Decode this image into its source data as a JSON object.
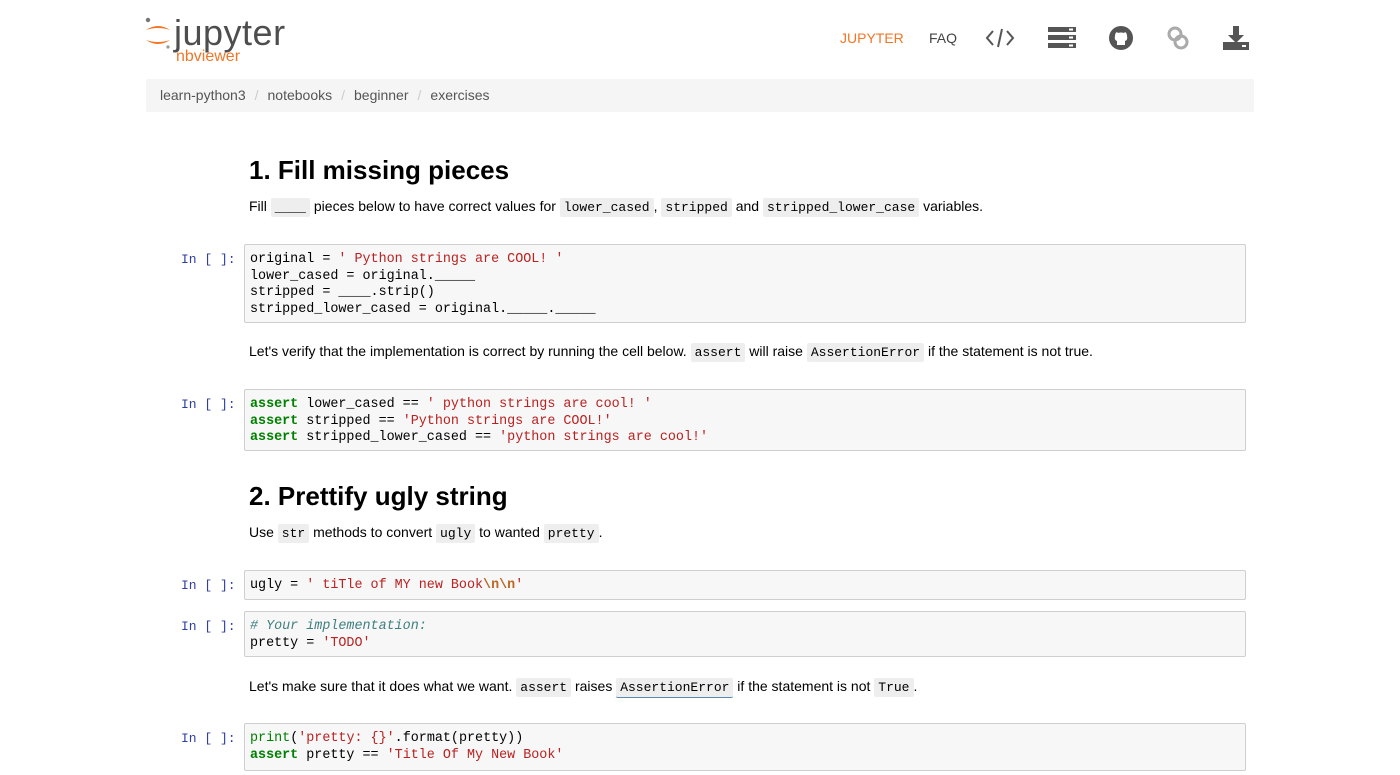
{
  "header": {
    "logo_text": "jupyter",
    "logo_sub": "nbviewer",
    "nav": {
      "jupyter": "JUPYTER",
      "faq": "FAQ"
    },
    "icons": [
      "code-icon",
      "server-icon",
      "github-icon",
      "link-icon",
      "download-icon"
    ]
  },
  "breadcrumb": [
    "learn-python3",
    "notebooks",
    "beginner",
    "exercises"
  ],
  "colors": {
    "accent": "#f37626",
    "prompt": "#303f9f"
  },
  "sections": {
    "s1": {
      "title": "1. Fill missing pieces",
      "para": {
        "t1": "Fill ",
        "c1": "____",
        "t2": " pieces below to have correct values for ",
        "c2": "lower_cased",
        "t3": ", ",
        "c3": "stripped",
        "t4": " and ",
        "c4": "stripped_lower_case",
        "t5": " variables."
      }
    },
    "verify1": {
      "t1": "Let's verify that the implementation is correct by running the cell below. ",
      "c1": "assert",
      "t2": " will raise ",
      "c2": "AssertionError",
      "t3": " if the statement is not true."
    },
    "s2": {
      "title": "2. Prettify ugly string",
      "para": {
        "t1": "Use ",
        "c1": "str",
        "t2": " methods to convert ",
        "c2": "ugly",
        "t3": " to wanted ",
        "c3": "pretty",
        "t4": "."
      }
    },
    "verify2": {
      "t1": "Let's make sure that it does what we want. ",
      "c1": "assert",
      "t2": " raises ",
      "c2": "AssertionError",
      "t3": " if the statement is not ",
      "c3": "True",
      "t4": "."
    }
  },
  "prompt": "In [ ]:",
  "cells": {
    "c1": {
      "l1a": "original = ",
      "l1b": "' Python strings are COOL! '",
      "l2": "lower_cased = original._____",
      "l3": "stripped = ____.strip()",
      "l4": "stripped_lower_cased = original._____._____"
    },
    "c2": {
      "kw": "assert",
      "l1a": " lower_cased == ",
      "l1b": "' python strings are cool! '",
      "l2a": " stripped == ",
      "l2b": "'Python strings are COOL!'",
      "l3a": " stripped_lower_cased == ",
      "l3b": "'python strings are cool!'"
    },
    "c3": {
      "a": "ugly = ",
      "b": "' tiTle of MY new Book",
      "esc": "\\n\\n",
      "c": "'"
    },
    "c4": {
      "comment": "# Your implementation:",
      "a": "pretty = ",
      "b": "'TODO'"
    },
    "c5": {
      "print": "print",
      "p1": "(",
      "s1": "'pretty: {}'",
      "p2": ".format(pretty))",
      "kw": "assert",
      "a": " pretty == ",
      "s2": "'Title Of My New Book'"
    }
  }
}
